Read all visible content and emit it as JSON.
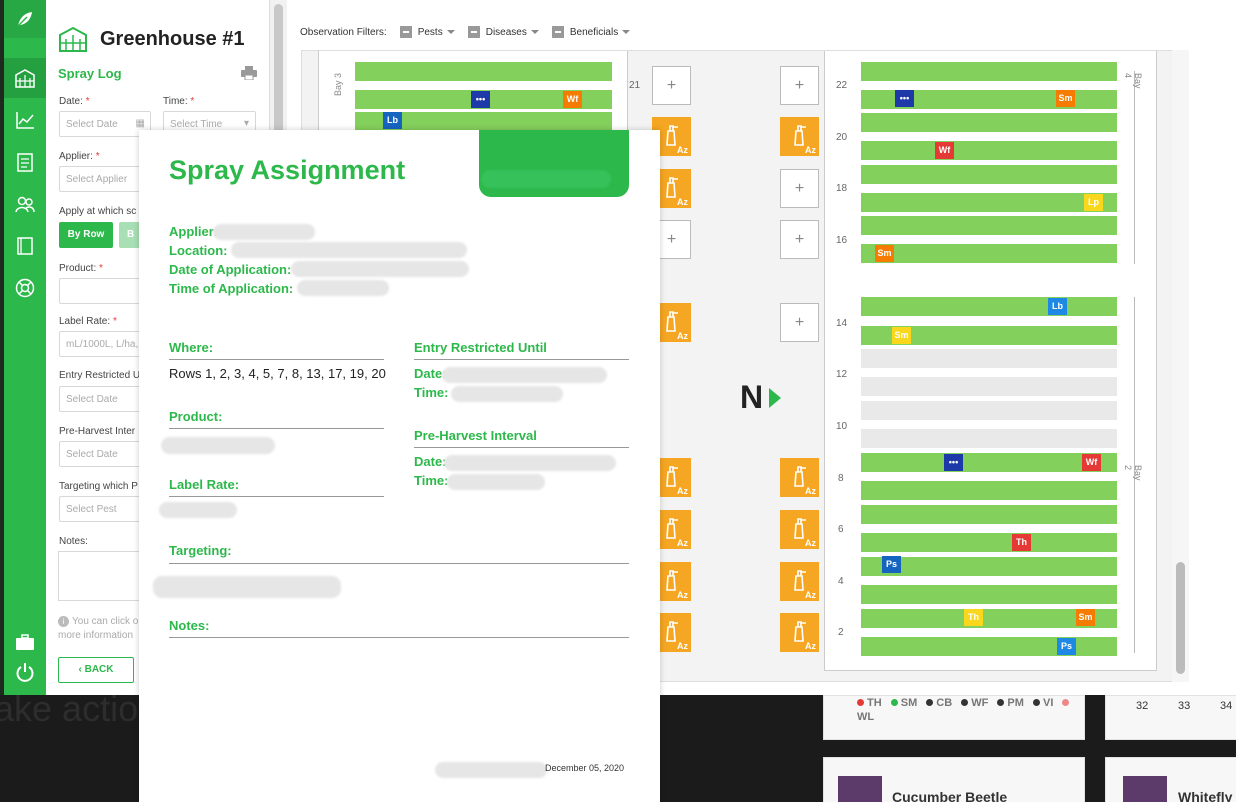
{
  "greenhouse": {
    "title": "Greenhouse #1"
  },
  "spray_log": {
    "title": "Spray Log",
    "date_label": "Date:",
    "date_placeholder": "Select Date",
    "time_label": "Time:",
    "time_placeholder": "Select Time",
    "applier_label": "Applier:",
    "applier_placeholder": "Select Applier",
    "apply_at_label": "Apply at which sc",
    "by_row": "By Row",
    "by_other": "B",
    "product_label": "Product:",
    "label_rate_label": "Label Rate:",
    "label_rate_placeholder": "mL/1000L, L/ha,...",
    "entry_label": "Entry Restricted U",
    "entry_placeholder": "Select Date",
    "preharvest_label": "Pre-Harvest Inter",
    "preharvest_placeholder": "Select Date",
    "targeting_label": "Targeting which P",
    "targeting_placeholder": "Select Pest",
    "notes_label": "Notes:",
    "info_line1": "You can click o",
    "info_line2": "more information",
    "back": "BACK"
  },
  "filters": {
    "label": "Observation Filters:",
    "pests": "Pests",
    "diseases": "Diseases",
    "beneficials": "Beneficials"
  },
  "map": {
    "north": "N",
    "bays": {
      "bay3": "Bay 3",
      "bay4": "Bay 4",
      "bay2": "Bay 2"
    },
    "left_numbers": [
      "21"
    ],
    "right_numbers": [
      "22",
      "20",
      "18",
      "16",
      "14",
      "12",
      "10",
      "8",
      "6",
      "4",
      "2"
    ],
    "az_label": "Az",
    "plus": "+",
    "tags": {
      "dots": "•••",
      "wf": "Wf",
      "lb": "Lb",
      "sm": "Sm",
      "lp": "Lp",
      "th": "Th",
      "ps": "Ps"
    }
  },
  "modal": {
    "title": "Spray Assignment",
    "applier": "Applier:",
    "location": "Location:",
    "date_app": "Date of Application:",
    "time_app": "Time of Application:",
    "where": "Where:",
    "rows": "Rows 1, 2, 3, 4, 5, 7, 8, 13, 17, 19, 20",
    "entry": "Entry Restricted Until",
    "date": "Date:",
    "time": "Time:",
    "product": "Product:",
    "preharvest": "Pre-Harvest Interval",
    "label_rate": "Label Rate:",
    "targeting": "Targeting:",
    "notes": "Notes:",
    "footer_date": "December 05, 2020"
  },
  "background": {
    "big_text": "ake action",
    "legend": [
      "TH",
      "SM",
      "CB",
      "WF",
      "PM",
      "VI",
      "WL"
    ],
    "nums": [
      "32",
      "33",
      "34"
    ],
    "card1": "Cucumber Beetle",
    "card2": "Whitefly"
  },
  "colors": {
    "green": "#2db84b",
    "row": "#84d05c",
    "az": "#f5a623",
    "red": "#e53935",
    "orange": "#f57c00",
    "blue": "#1e88e5",
    "yellow": "#f9d71c"
  }
}
